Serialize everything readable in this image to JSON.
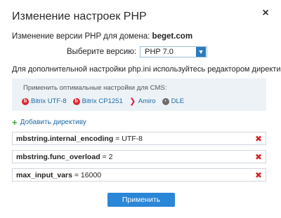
{
  "modal": {
    "title": "Изменение настроек PHP",
    "close_icon": "×"
  },
  "domain": {
    "label": "Изменение версии PHP для домена:",
    "name": "beget.com"
  },
  "version": {
    "label": "Выберите версию:",
    "selected": "PHP 7.0",
    "caret_icon": "chevron-down-icon"
  },
  "hint": "Для дополнительной настройки php.ini используйтесь редактором директив.",
  "cms": {
    "title": "Применить оптимальные настройки для CMS:",
    "items": [
      {
        "label": "Bitrix UTF-8",
        "icon": "bitrix-icon",
        "glyph": "b"
      },
      {
        "label": "Bitrix CP1251",
        "icon": "bitrix-icon",
        "glyph": "b"
      },
      {
        "label": "Amiro",
        "icon": "amiro-icon",
        "glyph": "❯"
      },
      {
        "label": "DLE",
        "icon": "dle-icon",
        "glyph": "•"
      }
    ]
  },
  "add_directive": {
    "label": "Добавить директиву",
    "icon": "plus-icon"
  },
  "directives": [
    {
      "name": "mbstring.internal_encoding",
      "value": " = UTF-8"
    },
    {
      "name": "mbstring.func_overload",
      "value": " = 2"
    },
    {
      "name": "max_input_vars",
      "value": " = 16000"
    }
  ],
  "apply_label": "Применить",
  "colors": {
    "accent": "#2a86d6",
    "link": "#1c6aa8",
    "remove": "#d32727",
    "add": "#3fa63a"
  }
}
